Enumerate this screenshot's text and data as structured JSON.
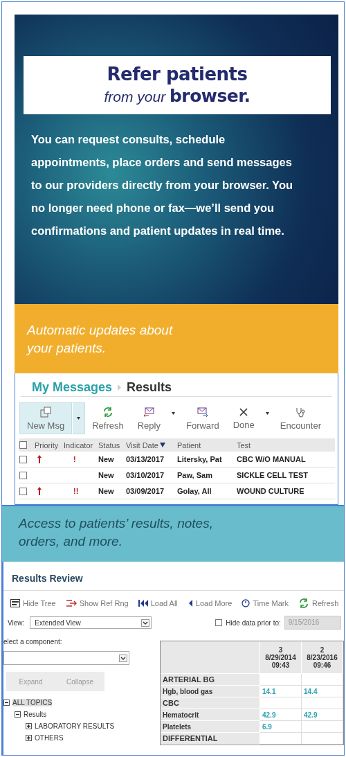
{
  "hero": {
    "title": "Refer patients",
    "subtitle": "*from your* **browser.**",
    "body": "You can request consults, schedule appointments, place orders and send messages to our providers directly from your browser. You no longer need phone or fax—we’ll send you confirmations and patient updates in real time."
  },
  "banner_updates": {
    "text": "Automatic updates about your patients."
  },
  "messages": {
    "breadcrumb": [
      {
        "label": "My Messages",
        "selected": false
      },
      {
        "label": "Results",
        "selected": true
      }
    ],
    "toolbar": [
      {
        "label": "New Msg",
        "dropdown": true,
        "selected": true
      },
      {
        "label": "Refresh",
        "dropdown": false,
        "selected": false
      },
      {
        "label": "Reply",
        "dropdown": true,
        "selected": false
      },
      {
        "label": "Forward",
        "dropdown": false,
        "selected": false
      },
      {
        "label": "Done",
        "dropdown": true,
        "selected": false
      },
      {
        "label": "Encounter",
        "dropdown": false,
        "selected": false
      }
    ],
    "select_all": {
      "checked": false
    },
    "columns": [
      {
        "label": "Priority",
        "sorted": false
      },
      {
        "label": "Indicator",
        "sorted": false
      },
      {
        "label": "Status",
        "sorted": false
      },
      {
        "label": "Visit Date",
        "sorted": true
      },
      {
        "label": "Patient",
        "sorted": false
      },
      {
        "label": "Test",
        "sorted": false
      }
    ],
    "rows": [
      {
        "checked": false,
        "priority": true,
        "indicator": "!",
        "status": "New",
        "visit_date": "03/13/2017",
        "patient": "Litersky, Pat",
        "test": "CBC W/O MANUAL"
      },
      {
        "checked": false,
        "priority": false,
        "status": "New",
        "visit_date": "03/10/2017",
        "patient": "Paw, Sam",
        "test": "SICKLE CELL TEST"
      },
      {
        "checked": false,
        "priority": true,
        "indicator": "!!",
        "status": "New",
        "visit_date": "03/09/2017",
        "patient": "Golay, All",
        "test": "WOUND CULTURE"
      }
    ]
  },
  "banner_access": {
    "text": "Access to patients’ results, notes, orders, and more."
  },
  "results": {
    "title": "Results Review",
    "toolbar": [
      {
        "label": "Hide Tree"
      },
      {
        "label": "Show Ref Rng"
      },
      {
        "label": "Load All"
      },
      {
        "label": "Load More"
      },
      {
        "label": "Time Mark"
      },
      {
        "label": "Refresh"
      }
    ],
    "view_label": "View:",
    "view_value": "Extended View",
    "hide_data": {
      "label": "Hide data prior to:",
      "checked": false,
      "value": "9/15/2016"
    },
    "component_label": "elect a component:",
    "buttons": [
      {
        "label": "Expand",
        "disabled": true
      },
      {
        "label": "Collapse",
        "disabled": true
      }
    ],
    "tree": [
      {
        "label": "ALL TOPICS",
        "expanded": true,
        "selected": true,
        "children": [
          {
            "label": "Results",
            "expanded": true,
            "selected": false,
            "children": [
              {
                "label": "LABORATORY RESULTS",
                "expanded": false,
                "selected": false
              },
              {
                "label": "OTHERS",
                "expanded": false,
                "selected": false
              }
            ]
          }
        ]
      }
    ],
    "grid": {
      "columns": [
        {
          "number": "3",
          "date": "8/29/2014",
          "time": "09:43"
        },
        {
          "number": "2",
          "date": "8/23/2016",
          "time": "09:46"
        }
      ],
      "rows": [
        {
          "kind": "group",
          "label": "ARTERIAL BG"
        },
        {
          "kind": "value",
          "label": "Hgb, blood gas",
          "values": [
            "14.1",
            "14.4"
          ]
        },
        {
          "kind": "group",
          "label": "CBC"
        },
        {
          "kind": "value",
          "label": "Hematocrit",
          "values": [
            "42.9",
            "42.9"
          ]
        },
        {
          "kind": "value",
          "label": "Platelets",
          "values": [
            "6.9"
          ]
        },
        {
          "kind": "group",
          "label": "DIFFERENTIAL"
        }
      ]
    }
  }
}
